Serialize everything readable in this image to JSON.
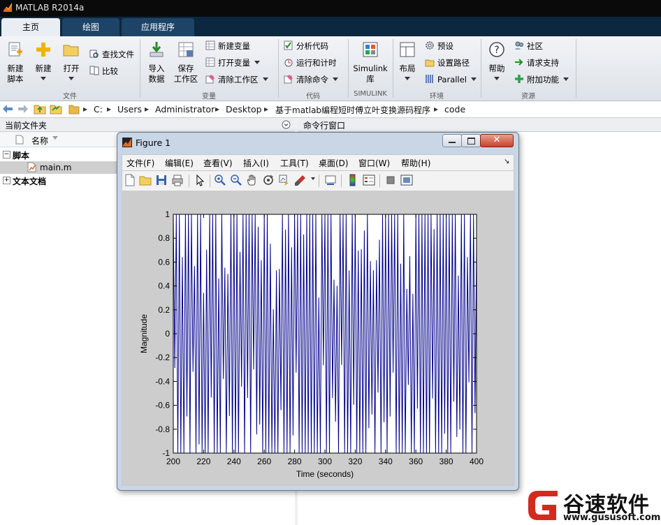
{
  "window": {
    "title": "MATLAB R2014a"
  },
  "tabs": [
    {
      "label": "主页",
      "active": true
    },
    {
      "label": "绘图",
      "active": false
    },
    {
      "label": "应用程序",
      "active": false
    }
  ],
  "ribbon": {
    "file": {
      "group": "文件",
      "new_script": [
        "新建",
        "脚本"
      ],
      "new": "新建",
      "open": "打开",
      "find_files": "查找文件",
      "compare": "比较"
    },
    "variable": {
      "group": "变量",
      "import": [
        "导入",
        "数据"
      ],
      "save_workspace": [
        "保存",
        "工作区"
      ],
      "new_variable": "新建变量",
      "open_variable": "打开变量",
      "clear_workspace": "清除工作区"
    },
    "code": {
      "group": "代码",
      "analyze": "分析代码",
      "run_time": "运行和计时",
      "clear_commands": "清除命令"
    },
    "simulink": {
      "group": "SIMULINK",
      "label": [
        "Simulink",
        "库"
      ]
    },
    "environment": {
      "group": "环境",
      "layout": "布局",
      "preferences": "预设",
      "set_path": "设置路径",
      "parallel": "Parallel"
    },
    "resources": {
      "group": "资源",
      "help": "帮助",
      "community": "社区",
      "support": "请求支持",
      "addons": "附加功能"
    }
  },
  "address": {
    "crumbs": [
      "C:",
      "Users",
      "Administrator",
      "Desktop",
      "基于matlab编程短时傅立叶变换源码程序",
      "code"
    ]
  },
  "current_folder": {
    "title": "当前文件夹",
    "col_name": "名称",
    "groups": [
      {
        "label": "脚本",
        "expanded": true,
        "items": [
          "main.m"
        ]
      },
      {
        "label": "文本文档",
        "expanded": false,
        "items": []
      }
    ]
  },
  "command_window": {
    "title": "命令行窗口"
  },
  "figure": {
    "title": "Figure 1",
    "menu": [
      "文件(F)",
      "编辑(E)",
      "查看(V)",
      "插入(I)",
      "工具(T)",
      "桌面(D)",
      "窗口(W)",
      "帮助(H)"
    ]
  },
  "chart_data": {
    "type": "line",
    "title": "",
    "xlabel": "Time (seconds)",
    "ylabel": "Magnitude",
    "xlim": [
      200,
      400
    ],
    "ylim": [
      -1,
      1
    ],
    "xticks": [
      200,
      220,
      240,
      260,
      280,
      300,
      320,
      340,
      360,
      380,
      400
    ],
    "yticks": [
      -1,
      -0.8,
      -0.6,
      -0.4,
      -0.2,
      0,
      0.2,
      0.4,
      0.6,
      0.8,
      1
    ],
    "xtick_labels": [
      "200",
      "220",
      "240",
      "260",
      "280",
      "300",
      "320",
      "340",
      "360",
      "380",
      "400"
    ],
    "ytick_labels": [
      "-1",
      "-0.8",
      "-0.6",
      "-0.4",
      "-0.2",
      "0",
      "0.2",
      "0.4",
      "0.6",
      "0.8",
      "1"
    ],
    "grid": false,
    "series": [
      {
        "color": "#00008b",
        "x_start": 200,
        "x_end": 400,
        "samples_per_unit": 1,
        "amplitude": 1
      }
    ]
  },
  "watermark": {
    "text": "谷速软件",
    "url": "www.gususoft.com"
  },
  "colors": {
    "accent": "#0c2740",
    "line": "#00008b"
  }
}
